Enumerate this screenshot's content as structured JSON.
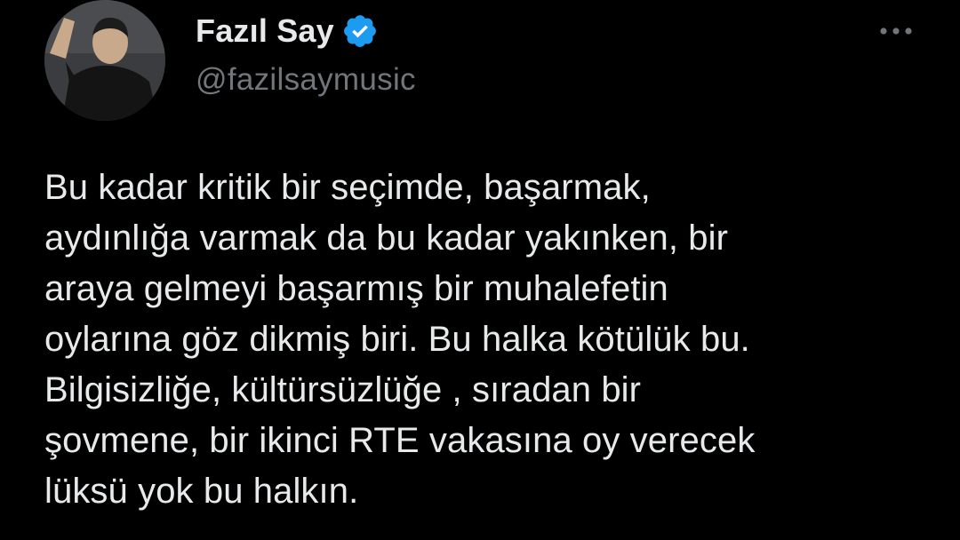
{
  "author": {
    "display_name": "Fazıl Say",
    "handle": "@fazilsaymusic",
    "verified": true,
    "avatar_icon": "profile-photo",
    "verified_icon": "verified-badge-icon"
  },
  "menu": {
    "icon": "more-options-icon"
  },
  "tweet": {
    "text": "Bu kadar kritik bir seçimde, başarmak,\naydınlığa varmak da bu kadar yakınken, bir\naraya gelmeyi başarmış bir muhalefetin\noylarına göz dikmiş biri. Bu halka kötülük bu.\nBilgisizliğe, kültürsüzlüğe , sıradan bir\nşovmene, bir ikinci RTE vakasına oy verecek\nlüksü yok bu halkın."
  },
  "colors": {
    "background": "#000000",
    "primary_text": "#e7e9ea",
    "secondary_text": "#71767b",
    "verified_blue": "#1d9bf0"
  }
}
